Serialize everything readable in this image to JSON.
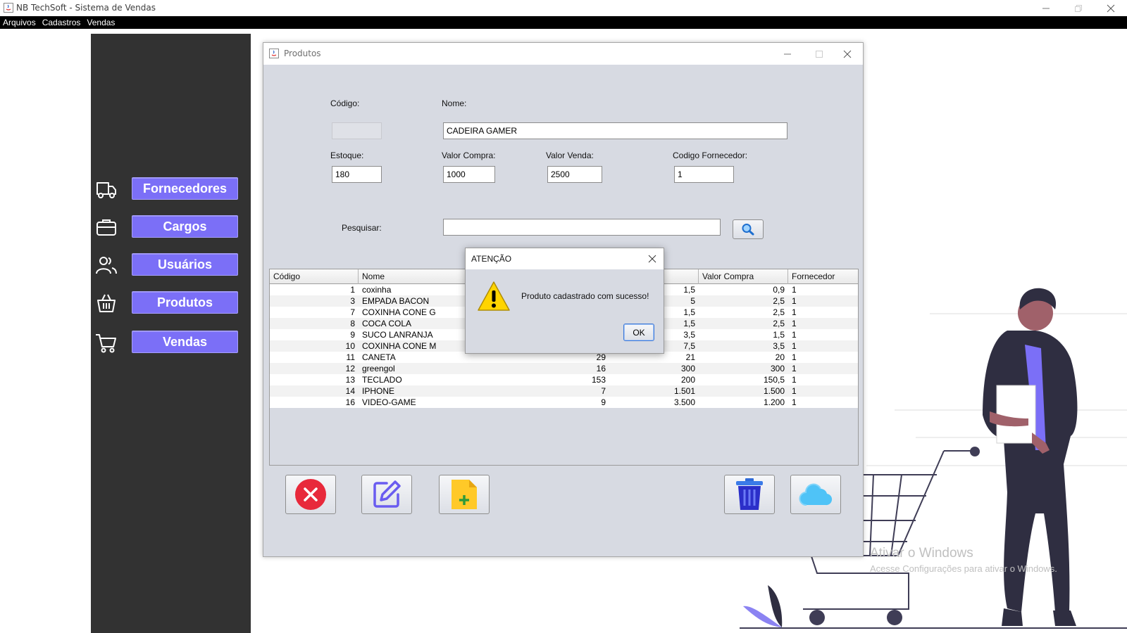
{
  "app": {
    "title": "NB TechSoft - Sistema de Vendas"
  },
  "menubar": {
    "items": [
      "Arquivos",
      "Cadastros",
      "Vendas"
    ]
  },
  "sidebar": {
    "items": [
      {
        "label": "Fornecedores",
        "icon": "truck-icon"
      },
      {
        "label": "Cargos",
        "icon": "briefcase-icon"
      },
      {
        "label": "Usuários",
        "icon": "users-icon"
      },
      {
        "label": "Produtos",
        "icon": "basket-icon"
      },
      {
        "label": "Vendas",
        "icon": "cart-icon"
      }
    ],
    "button_color": "#7b6ff7"
  },
  "frame": {
    "title": "Produtos",
    "form": {
      "codigo_label": "Código:",
      "codigo_value": "",
      "nome_label": "Nome:",
      "nome_value": "CADEIRA GAMER",
      "estoque_label": "Estoque:",
      "estoque_value": "180",
      "valor_compra_label": "Valor Compra:",
      "valor_compra_value": "1000",
      "valor_venda_label": "Valor Venda:",
      "valor_venda_value": "2500",
      "codigo_fornecedor_label": "Codigo Fornecedor:",
      "codigo_fornecedor_value": "1",
      "pesquisar_label": "Pesquisar:",
      "pesquisar_value": ""
    },
    "table": {
      "columns": [
        "Código",
        "Nome",
        "",
        "",
        "Valor Compra",
        "Fornecedor"
      ],
      "rows": [
        [
          "1",
          "coxinha",
          "",
          "1,5",
          "0,9",
          "1"
        ],
        [
          "3",
          "EMPADA BACON",
          "",
          "5",
          "2,5",
          "1"
        ],
        [
          "7",
          "COXINHA CONE G",
          "",
          "1,5",
          "2,5",
          "1"
        ],
        [
          "8",
          "COCA COLA",
          "",
          "1,5",
          "2,5",
          "1"
        ],
        [
          "9",
          "SUCO LANRANJA",
          "",
          "3,5",
          "1,5",
          "1"
        ],
        [
          "10",
          "COXINHA CONE M",
          "",
          "7,5",
          "3,5",
          "1"
        ],
        [
          "11",
          "CANETA",
          "29",
          "21",
          "20",
          "1"
        ],
        [
          "12",
          "greengol",
          "16",
          "300",
          "300",
          "1"
        ],
        [
          "13",
          "TECLADO",
          "153",
          "200",
          "150,5",
          "1"
        ],
        [
          "14",
          "IPHONE",
          "7",
          "1.501",
          "1.500",
          "1"
        ],
        [
          "16",
          "VIDEO-GAME",
          "9",
          "3.500",
          "1.200",
          "1"
        ]
      ]
    },
    "buttons": {
      "cancel": "cancel-icon",
      "edit": "edit-icon",
      "new": "new-file-icon",
      "delete": "trash-icon",
      "save": "cloud-icon"
    }
  },
  "dialog": {
    "title": "ATENÇÃO",
    "message": "Produto cadastrado com sucesso!",
    "ok_label": "OK"
  },
  "watermark": {
    "line1": "Ativar o Windows",
    "line2": "Acesse Configurações para ativar o Windows."
  }
}
